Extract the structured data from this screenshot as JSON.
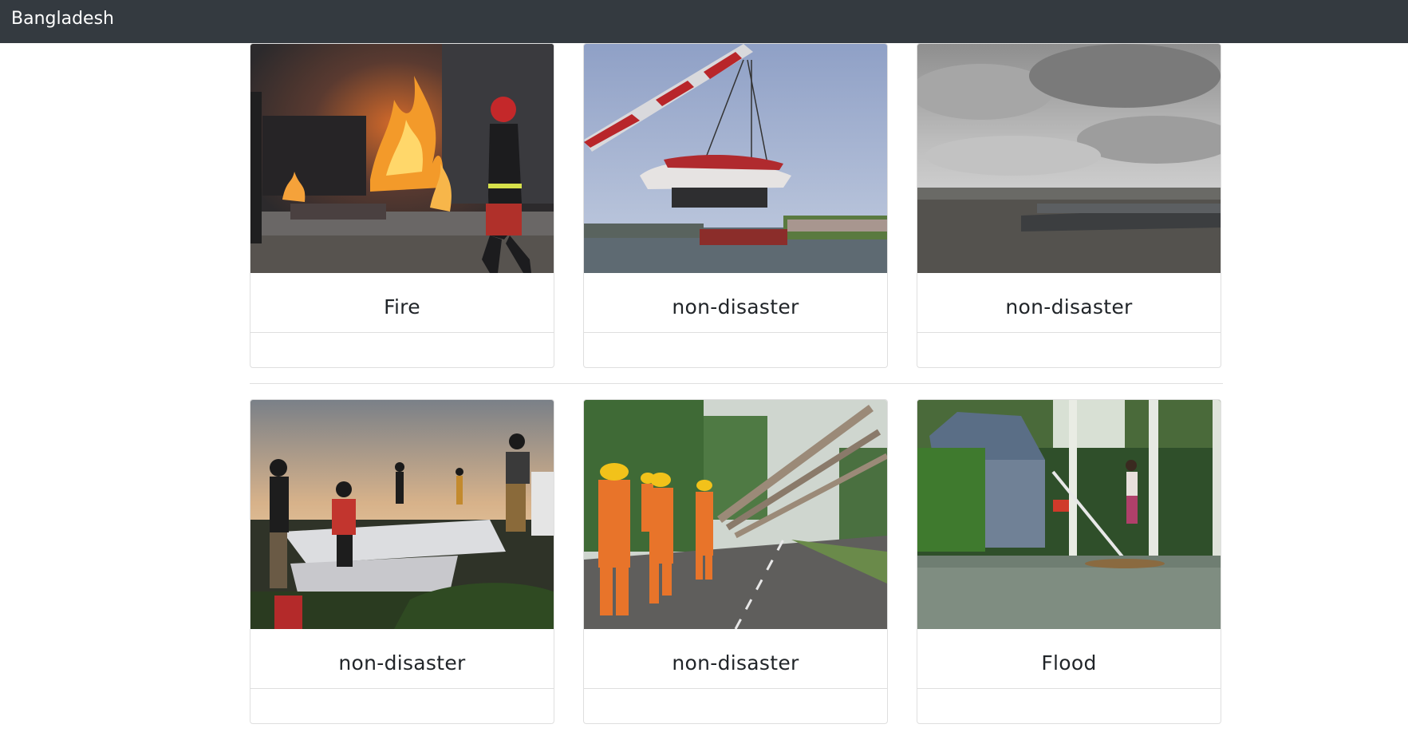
{
  "navbar": {
    "brand": "Bangladesh"
  },
  "cards": [
    {
      "title": "Fire",
      "image": "fire-scene-image"
    },
    {
      "title": "non-disaster",
      "image": "boat-crane-image"
    },
    {
      "title": "non-disaster",
      "image": "river-clouds-image"
    },
    {
      "title": "non-disaster",
      "image": "sunset-people-image"
    },
    {
      "title": "non-disaster",
      "image": "rescue-workers-image"
    },
    {
      "title": "Flood",
      "image": "flooded-house-image"
    }
  ],
  "colors": {
    "navbar": "#343a40",
    "card_border": "#dfdfdf",
    "title_text": "#212529"
  }
}
